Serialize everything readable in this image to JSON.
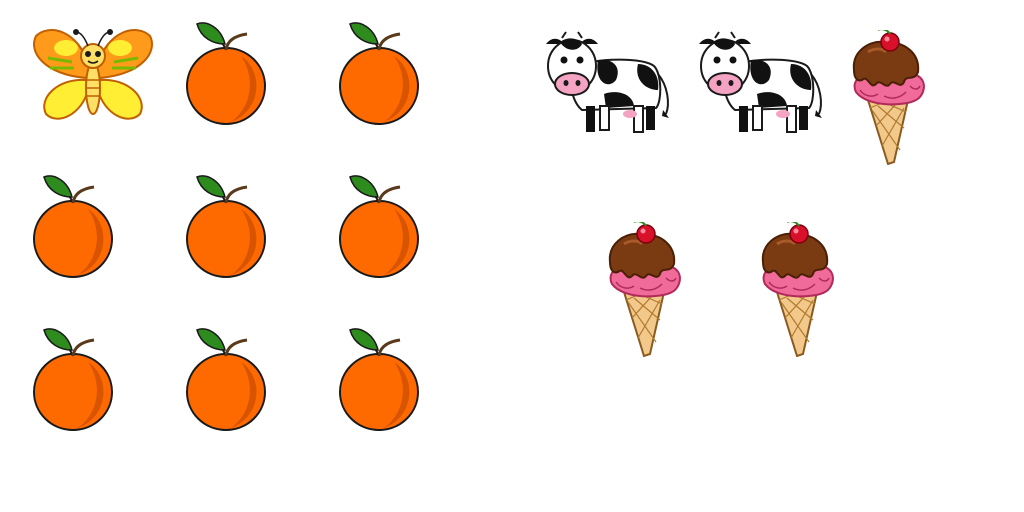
{
  "groups": [
    {
      "name": "left-group",
      "items": [
        "butterfly",
        "orange",
        "orange",
        "orange",
        "orange",
        "orange",
        "orange",
        "orange",
        "orange"
      ]
    },
    {
      "name": "right-group",
      "items": [
        "cow",
        "cow",
        "ice-cream",
        "ice-cream",
        "ice-cream"
      ]
    }
  ],
  "colors": {
    "orange_fill": "#ff6a00",
    "orange_shade": "#d85400",
    "leaf": "#2e8b1e",
    "butterfly_wing": "#ff9a1a",
    "butterfly_inner": "#ffee33",
    "cone": "#f2c98a",
    "scoop_pink": "#f06a9a",
    "chocolate": "#7a3b12",
    "cherry": "#d8102a"
  }
}
